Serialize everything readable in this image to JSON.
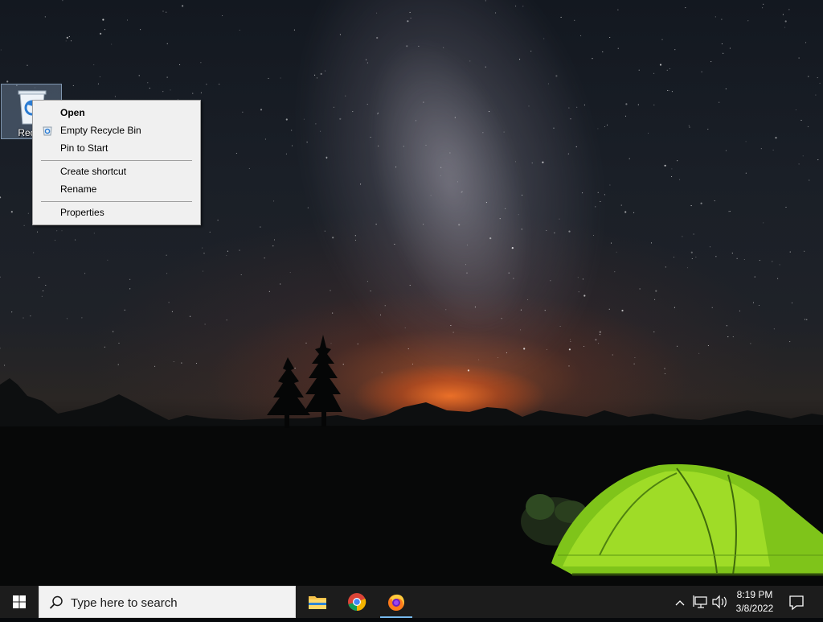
{
  "desktop": {
    "recycle_bin_label": "Recyc"
  },
  "context_menu": {
    "items": [
      {
        "label": "Open",
        "bold": true
      },
      {
        "label": "Empty Recycle Bin",
        "icon": "recycle-bin-icon"
      },
      {
        "label": "Pin to Start"
      },
      {
        "label": "Create shortcut"
      },
      {
        "label": "Rename"
      },
      {
        "label": "Properties"
      }
    ]
  },
  "taskbar": {
    "search_placeholder": "Type here to search",
    "apps": [
      {
        "name": "File Explorer",
        "icon": "folder-icon"
      },
      {
        "name": "Google Chrome",
        "icon": "chrome-icon"
      },
      {
        "name": "Firefox",
        "icon": "firefox-icon",
        "active": true
      }
    ],
    "tray_icons": [
      "chevron-up-icon",
      "network-icon",
      "volume-icon"
    ],
    "time": "8:19 PM",
    "date": "3/8/2022"
  },
  "colors": {
    "taskbar": "#1c1c1c",
    "menu_bg": "#f0f0f0",
    "active_indicator": "#76b9ed",
    "tent": "#8fd21e"
  }
}
